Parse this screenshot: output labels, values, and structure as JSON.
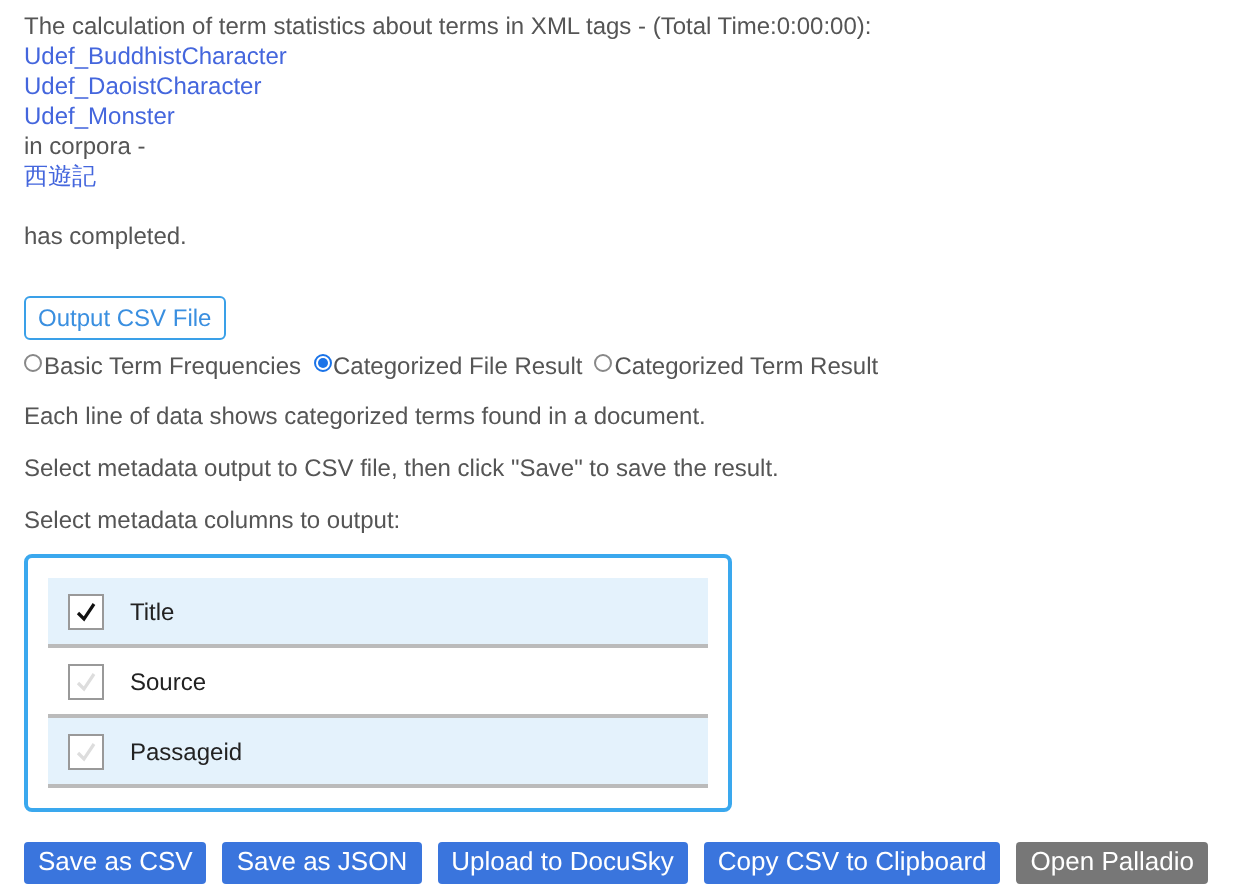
{
  "message": {
    "intro": "The calculation of term statistics about terms in XML tags - (Total Time:0:00:00):",
    "tags": [
      "Udef_BuddhistCharacter",
      "Udef_DaoistCharacter",
      "Udef_Monster"
    ],
    "corpora_label": "in corpora -",
    "corpora": [
      "西遊記"
    ],
    "status": "has completed."
  },
  "output_button": "Output CSV File",
  "result_types": [
    {
      "label": "Basic Term Frequencies",
      "selected": false
    },
    {
      "label": "Categorized File Result",
      "selected": true
    },
    {
      "label": "Categorized Term Result",
      "selected": false
    }
  ],
  "notes": [
    "Each line of data shows categorized terms found in a document.",
    "Select metadata output to CSV file, then click \"Save\" to save the result.",
    "Select metadata columns to output:"
  ],
  "columns": [
    {
      "label": "Title",
      "checked": true
    },
    {
      "label": "Source",
      "checked": false
    },
    {
      "label": "Passageid",
      "checked": false
    }
  ],
  "actions": [
    {
      "label": "Save as CSV",
      "kind": "primary"
    },
    {
      "label": "Save as JSON",
      "kind": "primary"
    },
    {
      "label": "Upload to DocuSky",
      "kind": "primary"
    },
    {
      "label": "Copy CSV to Clipboard",
      "kind": "primary"
    },
    {
      "label": "Open Palladio",
      "kind": "secondary"
    }
  ]
}
